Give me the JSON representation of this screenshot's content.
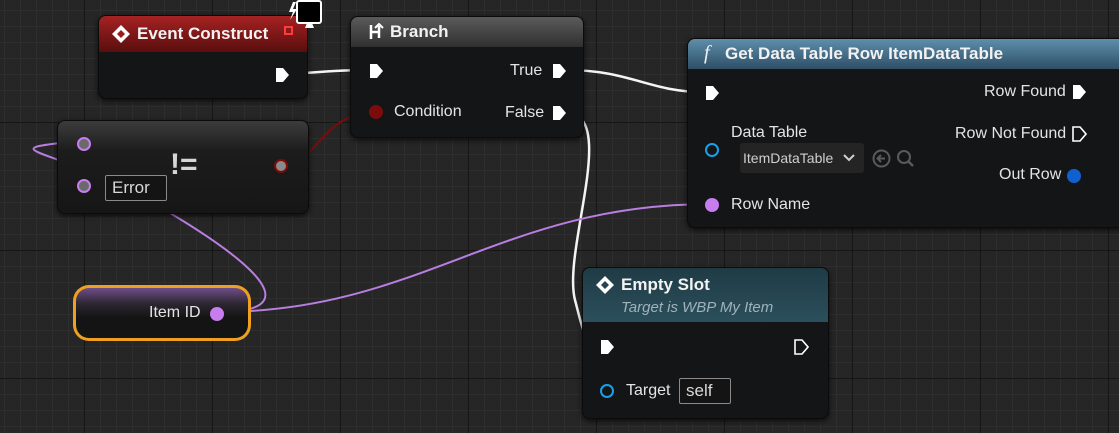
{
  "nodes": {
    "event_construct": {
      "title": "Event Construct"
    },
    "branch": {
      "title": "Branch",
      "true_label": "True",
      "false_label": "False",
      "condition_label": "Condition"
    },
    "not_equal": {
      "operator": "!=",
      "value": "Error"
    },
    "get_row": {
      "title": "Get Data Table Row ItemDataTable",
      "function_glyph": "f",
      "data_table_label": "Data Table",
      "data_table_value": "ItemDataTable",
      "row_name_label": "Row Name",
      "row_found_label": "Row Found",
      "row_not_found_label": "Row Not Found",
      "out_row_label": "Out Row"
    },
    "item_id": {
      "label": "Item ID"
    },
    "empty_slot": {
      "title": "Empty Slot",
      "subtitle": "Target is WBP My Item",
      "target_label": "Target",
      "target_value": "self"
    }
  },
  "icons": {
    "event": "event-diamond-icon",
    "branch": "branch-icon",
    "function": "function-icon",
    "client_server": "client-monitor-icon",
    "browse": "browse-arrow-icon",
    "search": "search-icon",
    "dropdown": "chevron-down-icon"
  },
  "colors": {
    "exec_wire": "#ffffff",
    "name_pin": "#c77dee",
    "bool_pin": "#8c0d0d",
    "struct_pin": "#1060d0",
    "object_pin": "#18a0e8",
    "event_header": "#9b1c1c",
    "function_header": "#4f7b96",
    "selection": "#f0a020"
  }
}
